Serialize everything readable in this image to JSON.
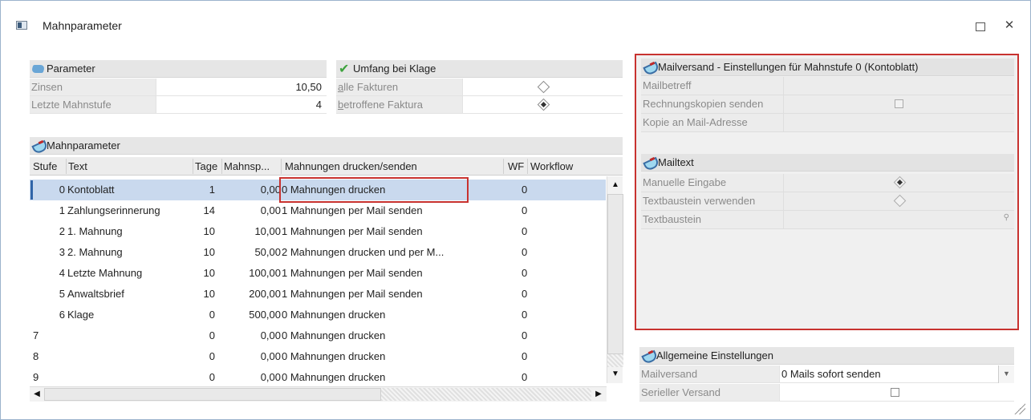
{
  "window": {
    "title": "Mahnparameter",
    "maximize": "☐",
    "close": "✕"
  },
  "parameter": {
    "header": "Parameter",
    "rows": [
      {
        "label": "Zinsen",
        "value": "10,50"
      },
      {
        "label": "Letzte Mahnstufe",
        "value": "4"
      }
    ]
  },
  "umfang": {
    "header": "Umfang bei Klage",
    "rows": [
      {
        "label": "alle Fakturen",
        "selected": false
      },
      {
        "label": "betroffene Faktura",
        "selected": true
      }
    ]
  },
  "mahn": {
    "header": "Mahnparameter",
    "columns": [
      "Stufe",
      "Text",
      "Tage",
      "Mahnsp...",
      "Mahnungen drucken/senden",
      "WF",
      "Workflow"
    ],
    "rows": [
      {
        "stufe": "0",
        "text": "Kontoblatt",
        "tage": "1",
        "mahnsp": "0,00",
        "mode": "0 Mahnungen drucken",
        "wf": "0"
      },
      {
        "stufe": "1",
        "text": "Zahlungserinnerung",
        "tage": "14",
        "mahnsp": "0,00",
        "mode": "1 Mahnungen per Mail senden",
        "wf": "0"
      },
      {
        "stufe": "2",
        "text": "1. Mahnung",
        "tage": "10",
        "mahnsp": "10,00",
        "mode": "1 Mahnungen per Mail senden",
        "wf": "0"
      },
      {
        "stufe": "3",
        "text": "2. Mahnung",
        "tage": "10",
        "mahnsp": "50,00",
        "mode": "2 Mahnungen drucken und per M...",
        "wf": "0"
      },
      {
        "stufe": "4",
        "text": "Letzte Mahnung",
        "tage": "10",
        "mahnsp": "100,00",
        "mode": "1 Mahnungen per Mail senden",
        "wf": "0"
      },
      {
        "stufe": "5",
        "text": "Anwaltsbrief",
        "tage": "10",
        "mahnsp": "200,00",
        "mode": "1 Mahnungen per Mail senden",
        "wf": "0"
      },
      {
        "stufe": "6",
        "text": "Klage",
        "tage": "0",
        "mahnsp": "500,00",
        "mode": "0 Mahnungen drucken",
        "wf": "0"
      },
      {
        "stufe": "7",
        "text": "",
        "tage": "0",
        "mahnsp": "0,00",
        "mode": "0 Mahnungen drucken",
        "wf": "0"
      },
      {
        "stufe": "8",
        "text": "",
        "tage": "0",
        "mahnsp": "0,00",
        "mode": "0 Mahnungen drucken",
        "wf": "0"
      },
      {
        "stufe": "9",
        "text": "",
        "tage": "0",
        "mahnsp": "0,00",
        "mode": "0 Mahnungen drucken",
        "wf": "0"
      }
    ],
    "selected_row": 0
  },
  "mailversand": {
    "header": "Mailversand - Einstellungen für Mahnstufe 0 (Kontoblatt)",
    "rows": [
      {
        "label": "Mailbetreff"
      },
      {
        "label": "Rechnungskopien senden"
      },
      {
        "label": "Kopie an Mail-Adresse"
      }
    ]
  },
  "mailtext": {
    "header": "Mailtext",
    "rows": [
      {
        "label": "Manuelle Eingabe",
        "selected": true
      },
      {
        "label": "Textbaustein verwenden",
        "selected": false
      },
      {
        "label": "Textbaustein"
      }
    ]
  },
  "allgemein": {
    "header": "Allgemeine Einstellungen",
    "mailversand_label": "Mailversand",
    "mailversand_value": "0 Mails sofort senden",
    "seriell_label": "Serieller Versand"
  },
  "colors": {
    "highlight_border": "#c8322f",
    "selected_row": "#c9d9ee",
    "focus": "#3165a8"
  }
}
